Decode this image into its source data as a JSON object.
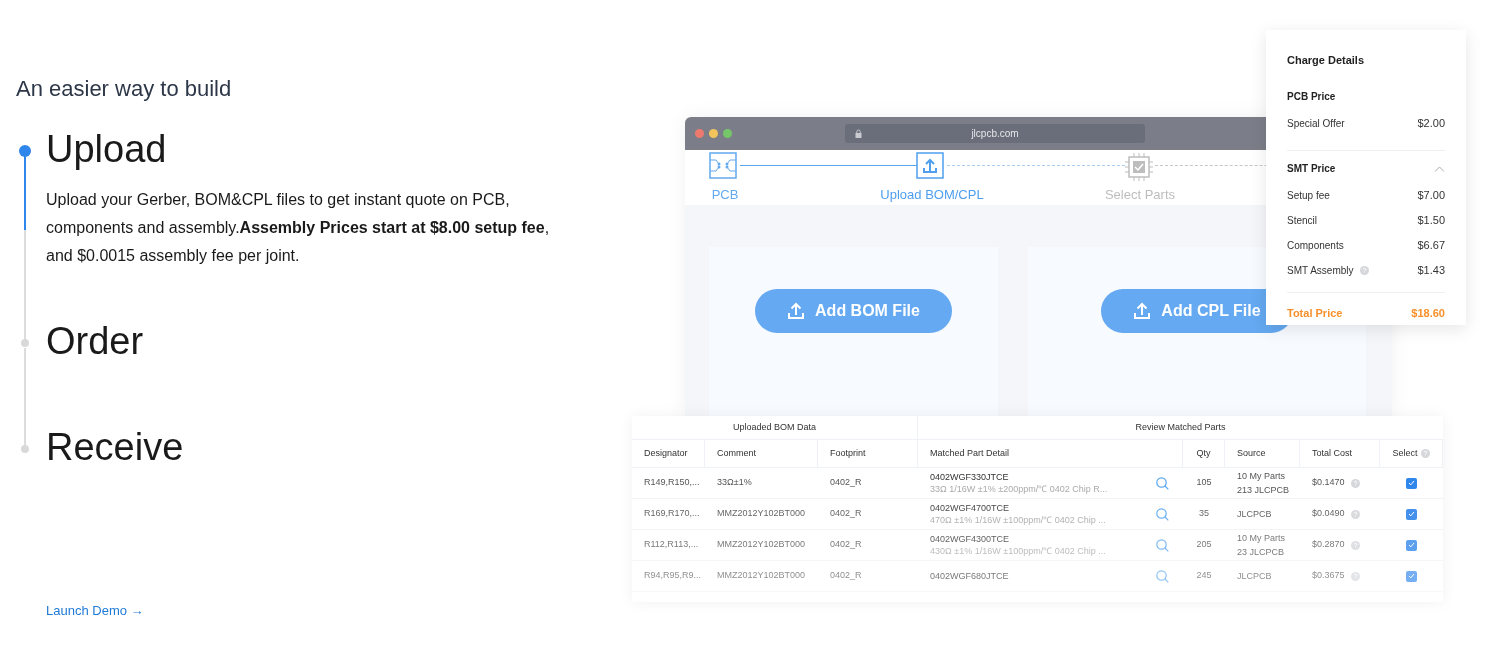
{
  "heading": "An easier way to build",
  "steps": [
    {
      "title": "Upload",
      "selected": true,
      "description": "Upload your Gerber, BOM&CPL files to get instant quote on PCB, components and assembly.**Assembly Prices start at $8.00 setup fee**, and $0.0015 assembly fee per joint."
    },
    {
      "title": "Order",
      "selected": false
    },
    {
      "title": "Receive",
      "selected": false
    }
  ],
  "launch_link": "Launch Demo →",
  "browser": {
    "url": "jlcpcb.com",
    "progress": [
      {
        "label": "PCB",
        "completed": true,
        "selected": false,
        "kind": "pcb"
      },
      {
        "label": "Upload BOM/CPL",
        "completed": false,
        "selected": true,
        "kind": "upload"
      },
      {
        "label": "Select Parts",
        "completed": false,
        "selected": false,
        "kind": "chip"
      }
    ],
    "buttons": [
      "Add BOM File",
      "Add CPL File"
    ]
  },
  "table": {
    "groups": [
      "Uploaded BOM Data",
      "Review Matched Parts"
    ],
    "columns": [
      "Designator",
      "Comment",
      "Footprint",
      "Matched Part Detail",
      "Qty",
      "Source",
      "Total Cost",
      "Select"
    ],
    "rows": [
      {
        "designator": "R149,R150,...",
        "comment": "33Ω±1%",
        "footprint": "0402_R",
        "part": "0402WGF330JTCE",
        "part_detail": "33Ω 1/16W ±1% ±200ppm/℃ 0402 Chip R...",
        "qty": "105",
        "source": [
          "10 My Parts",
          "213 JLCPCB"
        ],
        "cost": "$0.1470",
        "checked": true
      },
      {
        "designator": "R169,R170,...",
        "comment": "MMZ2012Y102BT000",
        "footprint": "0402_R",
        "part": "0402WGF4700TCE",
        "part_detail": "470Ω ±1% 1/16W ±100ppm/℃ 0402 Chip ...",
        "qty": "35",
        "source": [
          "JLCPCB"
        ],
        "cost": "$0.0490",
        "checked": true
      },
      {
        "designator": "R112,R113,...",
        "comment": "MMZ2012Y102BT000",
        "footprint": "0402_R",
        "part": "0402WGF4300TCE",
        "part_detail": "430Ω ±1% 1/16W ±100ppm/℃ 0402 Chip ...",
        "qty": "205",
        "source": [
          "10 My Parts",
          "23 JLCPCB"
        ],
        "cost": "$0.2870",
        "checked": true
      },
      {
        "designator": "R94,R95,R9...",
        "comment": "MMZ2012Y102BT000",
        "footprint": "0402_R",
        "part": "0402WGF680JTCE",
        "qty": "245",
        "source": [
          "JLCPCB"
        ],
        "cost": "$0.3675",
        "checked": true
      }
    ]
  },
  "charges": {
    "title": "Charge Details",
    "sections": [
      {
        "title": "PCB Price",
        "items": [
          {
            "label": "Special Offer",
            "value": "$2.00"
          }
        ]
      },
      {
        "title": "SMT Price",
        "expanded": true,
        "items": [
          {
            "label": "Setup fee",
            "value": "$7.00"
          },
          {
            "label": "Stencil",
            "value": "$1.50"
          },
          {
            "label": "Components",
            "value": "$6.67"
          },
          {
            "label": "SMT Assembly",
            "value": "$1.43",
            "help": true
          }
        ]
      }
    ],
    "total_label": "Total Price",
    "total_value": "$18.60"
  }
}
